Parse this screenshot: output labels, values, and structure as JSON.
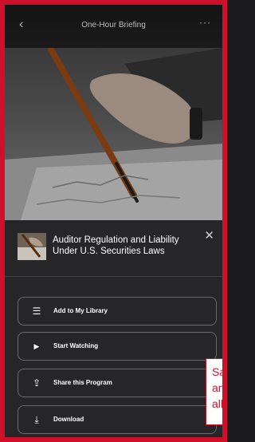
{
  "header": {
    "title": "One-Hour Briefing",
    "back_icon": "chevron-left-icon",
    "more_icon": "ellipsis-icon"
  },
  "program": {
    "title": "Auditor Regulation and Liability Under U.S. Securities Laws"
  },
  "actions": [
    {
      "label": "Add to My Library",
      "icon": "list-icon"
    },
    {
      "label": "Start Watching",
      "icon": "play-icon"
    },
    {
      "label": "Share this Program",
      "icon": "share-icon"
    },
    {
      "label": "Download",
      "icon": "download-icon"
    }
  ],
  "tooltip": {
    "text": "Sa\nan\nall"
  },
  "colors": {
    "frame": "#d0102a",
    "sheet": "#262628",
    "text": "#ffffff"
  }
}
